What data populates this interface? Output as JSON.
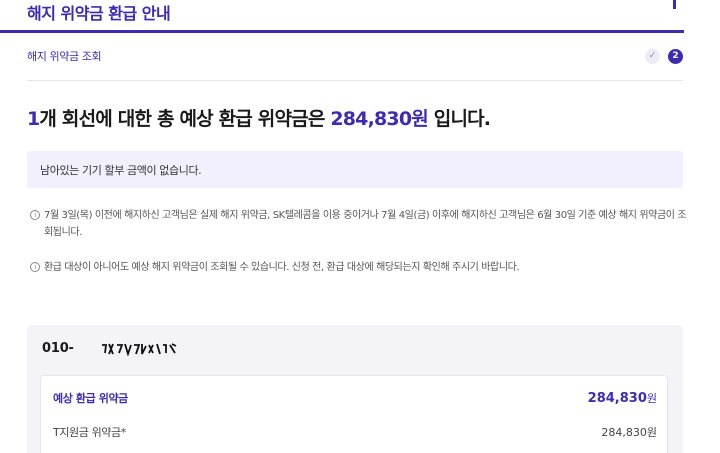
{
  "header": {
    "title": "해지 위약금 환급 안내"
  },
  "step": {
    "label": "해지 위약금 조회",
    "done_mark": "✓",
    "current_number": "2"
  },
  "summary": {
    "line_count": "1",
    "text_mid": "개 회선에 대한 총 예상 환급 위약금은 ",
    "amount": "284,830원",
    "text_end": " 입니다."
  },
  "notice": {
    "text": "남아있는 기기 할부 금액이 없습니다."
  },
  "info": [
    {
      "icon": "i",
      "text": "7월 3일(목) 이전에 해지하신 고객님은 실제 해지 위약금, SK텔레콤을 이용 중이거나 7월 4일(금) 이후에 해지하신 고객님은 6월 30일 기준 예상 해지 위약금이 조회됩니다."
    },
    {
      "icon": "i",
      "text": "환급 대상이 아니어도 예상 해지 위약금이 조회될 수 있습니다. 신청 전, 환급 대상에 해당되는지 확인해 주시기 바랍니다."
    }
  ],
  "card": {
    "phone_prefix": "010-",
    "rows": [
      {
        "label": "예상 환급 위약금",
        "amount": "284,830",
        "unit": "원"
      },
      {
        "label": "T지원금 위약금*",
        "amount": "284,830원"
      }
    ]
  },
  "colors": {
    "accent": "#3d2bb3",
    "notice_bg": "#f2efff",
    "card_bg": "#f4f4f6"
  }
}
